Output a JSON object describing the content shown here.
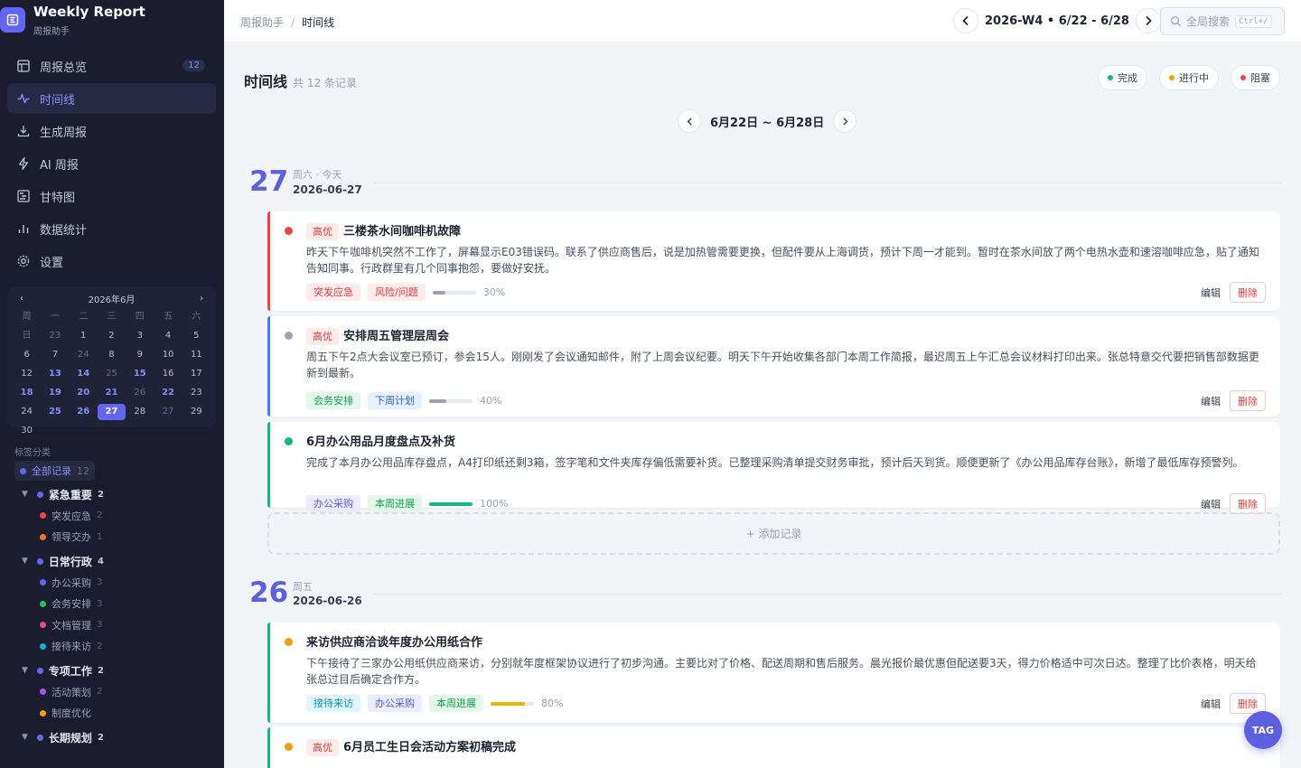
{
  "brand": {
    "title": "Weekly Report",
    "subtitle": "周报助手"
  },
  "nav": [
    {
      "label": "周报总览",
      "icon": "layout-icon",
      "badge": "12"
    },
    {
      "label": "时间线",
      "icon": "activity-icon",
      "active": true
    },
    {
      "label": "生成周报",
      "icon": "download-icon"
    },
    {
      "label": "AI 周报",
      "icon": "lightning-icon"
    },
    {
      "label": "甘特图",
      "icon": "gantt-icon"
    },
    {
      "label": "数据统计",
      "icon": "bar-chart-icon"
    },
    {
      "label": "设置",
      "icon": "gear-icon"
    }
  ],
  "calendar": {
    "month": "2026年6月",
    "prev": "‹",
    "next": "›",
    "headers": [
      "周",
      "一",
      "二",
      "三",
      "四",
      "五",
      "六",
      "日"
    ],
    "rows": [
      [
        "23",
        "1",
        "2",
        "3",
        "4",
        "5",
        "6",
        "7"
      ],
      [
        "24",
        "8",
        "9",
        "10",
        "11",
        "12",
        "13",
        "14"
      ],
      [
        "25",
        "15",
        "16",
        "17",
        "18",
        "19",
        "20",
        "21"
      ],
      [
        "26",
        "22",
        "23",
        "24",
        "25",
        "26",
        "27",
        "28"
      ],
      [
        "27",
        "29",
        "30",
        "",
        "",
        "",
        "",
        ""
      ]
    ]
  },
  "tags": {
    "title": "标签分类",
    "all": {
      "label": "全部记录",
      "count": "12"
    },
    "groups": [
      {
        "label": "紧急重要",
        "count": "2",
        "color": "#6366f1",
        "items": [
          {
            "label": "突发应急",
            "count": "2",
            "color": "#ef4444"
          },
          {
            "label": "领导交办",
            "count": "1",
            "color": "#f97316"
          }
        ]
      },
      {
        "label": "日常行政",
        "count": "4",
        "color": "#6366f1",
        "items": [
          {
            "label": "办公采购",
            "count": "3",
            "color": "#6366f1"
          },
          {
            "label": "会务安排",
            "count": "3",
            "color": "#22c55e"
          },
          {
            "label": "文档管理",
            "count": "3",
            "color": "#ec4899"
          },
          {
            "label": "接待来访",
            "count": "2",
            "color": "#06b6d4"
          }
        ]
      },
      {
        "label": "专项工作",
        "count": "2",
        "color": "#6366f1",
        "items": [
          {
            "label": "活动策划",
            "count": "2",
            "color": "#a855f7"
          },
          {
            "label": "制度优化",
            "count": "",
            "color": "#f59e0b"
          }
        ]
      },
      {
        "label": "长期规划",
        "count": "2",
        "color": "#6366f1",
        "items": []
      }
    ]
  },
  "topbar": {
    "crumb_root": "周报助手",
    "crumb_sep": "/",
    "crumb_current": "时间线",
    "week": "2026-W4 • 6/22 - 6/28",
    "search_placeholder": "全局搜索",
    "search_kbd": "Ctrl+/"
  },
  "main": {
    "title": "时间线",
    "count": "共 12 条记录",
    "legend": [
      {
        "label": "完成",
        "color": "#10b981"
      },
      {
        "label": "进行中",
        "color": "#f59e0b"
      },
      {
        "label": "阻塞",
        "color": "#ef4444"
      }
    ],
    "range": "6月22日 ~ 6月28日",
    "add_label": "+ 添加记录",
    "fab": "TAG"
  },
  "days": [
    {
      "num": "27",
      "week": "周六 · 今天",
      "date": "2026-06-27"
    },
    {
      "num": "26",
      "week": "周五",
      "date": "2026-06-26"
    }
  ],
  "cards": [
    {
      "priority": "高优",
      "title": "三楼茶水间咖啡机故障",
      "status_color": "#ef4444",
      "bar_color": "#ef4444",
      "body": "昨天下午咖啡机突然不工作了，屏幕显示E03错误码。联系了供应商售后，说是加热管需要更换，但配件要从上海调货，预计下周一才能到。暂时在茶水间放了两个电热水壶和速溶咖啡应急，贴了通知告知同事。行政群里有几个同事抱怨，要做好安抚。",
      "tags": [
        {
          "label": "突发应急",
          "bg": "#fdeaea",
          "fg": "#e03b3b"
        },
        {
          "label": "风险/问题",
          "bg": "#fdeaea",
          "fg": "#e03b3b"
        }
      ],
      "progress": 30,
      "progress_label": "30%",
      "progress_color": "#9aa3b5",
      "edit": "编辑",
      "delete": "删除"
    },
    {
      "priority": "高优",
      "title": "安排周五管理层周会",
      "status_color": "#9aa3b5",
      "bar_color": "#3b82f6",
      "body": "周五下午2点大会议室已预订，参会15人。刚刚发了会议通知邮件，附了上周会议纪要。明天下午开始收集各部门本周工作简报，最迟周五上午汇总会议材料打印出来。张总特意交代要把销售部数据更新到最新。",
      "tags": [
        {
          "label": "会务安排",
          "bg": "#e3f7ec",
          "fg": "#16a34a"
        },
        {
          "label": "下周计划",
          "bg": "#e6efff",
          "fg": "#2563eb"
        }
      ],
      "progress": 40,
      "progress_label": "40%",
      "progress_color": "#9aa3b5",
      "edit": "编辑",
      "delete": "删除"
    },
    {
      "priority": "",
      "title": "6月办公用品月度盘点及补货",
      "status_color": "#10b981",
      "bar_color": "#10b981",
      "body": "完成了本月办公用品库存盘点，A4打印纸还剩3箱，签字笔和文件夹库存偏低需要补货。已整理采购清单提交财务审批，预计后天到货。顺便更新了《办公用品库存台账》，新增了最低库存预警列。",
      "tags": [
        {
          "label": "办公采购",
          "bg": "#ecebff",
          "fg": "#5b5fe0"
        },
        {
          "label": "本周进展",
          "bg": "#e3f7ec",
          "fg": "#16a34a"
        }
      ],
      "progress": 100,
      "progress_label": "100%",
      "progress_color": "#10b981",
      "edit": "编辑",
      "delete": "删除"
    },
    {
      "priority": "",
      "title": "来访供应商洽谈年度办公用纸合作",
      "status_color": "#f59e0b",
      "bar_color": "#10b981",
      "body": "下午接待了三家办公用纸供应商来访，分别就年度框架协议进行了初步沟通。主要比对了价格、配送周期和售后服务。晨光报价最优惠但配送要3天，得力价格适中可次日达。整理了比价表格，明天给张总过目后确定合作方。",
      "tags": [
        {
          "label": "接待来访",
          "bg": "#e0f7fa",
          "fg": "#0891b2"
        },
        {
          "label": "办公采购",
          "bg": "#ecebff",
          "fg": "#5b5fe0"
        },
        {
          "label": "本周进展",
          "bg": "#e3f7ec",
          "fg": "#16a34a"
        }
      ],
      "progress": 80,
      "progress_label": "80%",
      "progress_color": "#eab308",
      "edit": "编辑",
      "delete": "删除"
    },
    {
      "priority": "高优",
      "title": "6月员工生日会活动方案初稿完成",
      "status_color": "#f59e0b",
      "bar_color": "#10b981",
      "body": "",
      "tags": [],
      "progress": null,
      "progress_label": "",
      "progress_color": "",
      "edit": "",
      "delete": ""
    }
  ]
}
